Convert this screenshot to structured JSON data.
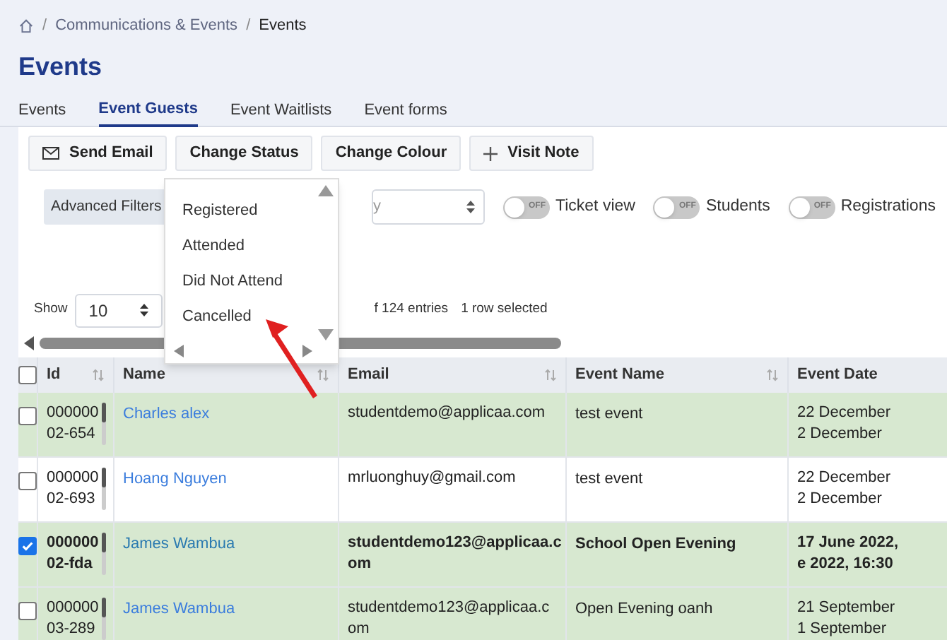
{
  "breadcrumb": [
    "Communications & Events",
    "Events"
  ],
  "breadcrumb_separator": "/",
  "title": "Events",
  "tabs": [
    {
      "label": "Events",
      "selected": false
    },
    {
      "label": "Event Guests",
      "selected": true
    },
    {
      "label": "Event Waitlists",
      "selected": false
    },
    {
      "label": "Event forms",
      "selected": false
    }
  ],
  "toolbar": [
    {
      "label": "Send Email",
      "kind": "mail"
    },
    {
      "label": "Change Status",
      "kind": "plain"
    },
    {
      "label": "Change Colour",
      "kind": "plain"
    },
    {
      "label": "Visit Note",
      "kind": "plus"
    }
  ],
  "filters": {
    "advanced_label": "Advanced Filters",
    "select_value": "y"
  },
  "toggles": [
    {
      "label": "Ticket view",
      "on": false,
      "state_label": "OFF"
    },
    {
      "label": "Students",
      "on": false,
      "state_label": "OFF"
    },
    {
      "label": "Registrations",
      "on": false,
      "state_label": "OFF"
    }
  ],
  "status_menu": {
    "expanded": true,
    "items": [
      "Registered",
      "Attended",
      "Did Not Attend",
      "Cancelled"
    ]
  },
  "length": {
    "label": "Show",
    "value": "10"
  },
  "info": "f 124 entries",
  "selection_info": "1 row selected",
  "table": {
    "header_checked": false,
    "columns": [
      "Id",
      "Name",
      "Email",
      "Event Name",
      "Event Date"
    ],
    "rows": [
      {
        "selected": false,
        "highlighted": true,
        "id": [
          "000000",
          "02-654"
        ],
        "name": "Charles alex",
        "email": [
          "studentdemo@applicaa.com"
        ],
        "event": "test event",
        "date": [
          "22 December",
          "2 December"
        ]
      },
      {
        "selected": false,
        "highlighted": false,
        "id": [
          "000000",
          "02-693"
        ],
        "name": "Hoang Nguyen",
        "email": [
          "mrluonghuy@gmail.com"
        ],
        "event": "test event",
        "date": [
          "22 December",
          "2 December"
        ]
      },
      {
        "selected": true,
        "highlighted": true,
        "id": [
          "000000",
          "02-fda"
        ],
        "name": "James Wambua",
        "email": [
          "studentdemo123@applicaa.c",
          "om"
        ],
        "event": "School Open Evening",
        "date": [
          "17 June 2022,",
          "e 2022, 16:30"
        ]
      },
      {
        "selected": false,
        "highlighted": true,
        "id": [
          "000000",
          "03-289"
        ],
        "name": "James Wambua",
        "email": [
          "studentdemo123@applicaa.c",
          "om"
        ],
        "event": "Open Evening oanh",
        "date": [
          "21 September",
          "1 September"
        ]
      }
    ]
  }
}
